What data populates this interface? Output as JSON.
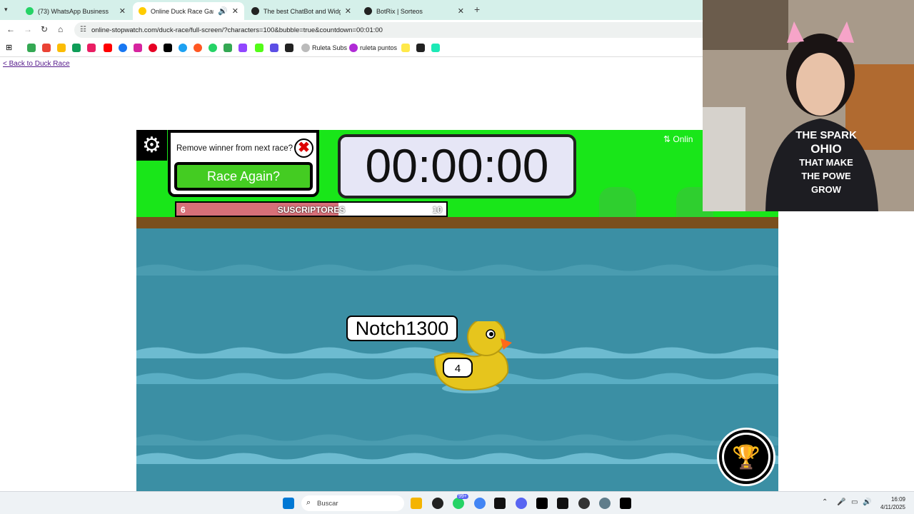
{
  "browser": {
    "tabs": [
      {
        "label": "(73) WhatsApp Business",
        "color": "#25d366"
      },
      {
        "label": "Online Duck Race Game",
        "color": "#ffcc00",
        "active": true
      },
      {
        "label": "The best ChatBot and Widgets",
        "color": "#222222"
      },
      {
        "label": "BotRix | Sorteos",
        "color": "#222222"
      }
    ],
    "new_tab": "+",
    "url": "online-stopwatch.com/duck-race/full-screen/?characters=100&bubble=true&countdown=00:01:00",
    "bookmarks": [
      "Ruleta Subs",
      "ruleta puntos"
    ]
  },
  "page": {
    "back_link": "< Back to Duck Race"
  },
  "game": {
    "remove_winner_label": "Remove winner from next race?",
    "race_again_label": "Race Again?",
    "timer": "00:00:00",
    "progress": {
      "low": "6",
      "label": "SUSCRIPTORES",
      "high": "10",
      "fraction": 0.6
    },
    "online_label": "Onlin",
    "duck_name": "Notch1300",
    "duck_number": "4"
  },
  "webcam": {
    "shirt_text_1": "THE SPARK",
    "shirt_text_2": "OHIO",
    "shirt_text_3": "THAT MAKE",
    "shirt_text_4": "THE POWE",
    "shirt_text_5": "GROW"
  },
  "taskbar": {
    "search_placeholder": "Buscar",
    "time": "16:09",
    "date": "4/11/2025",
    "badge": "99+"
  },
  "colors": {
    "sky": "#19e619",
    "water": "#3b8fa4",
    "progress_fill": "#d77078",
    "race_button": "#44cc22"
  }
}
